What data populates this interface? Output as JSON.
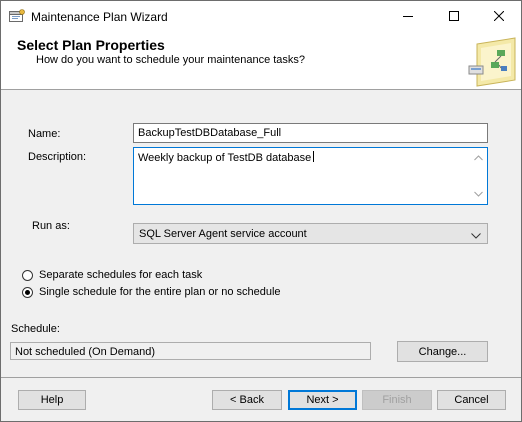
{
  "window": {
    "title": "Maintenance Plan Wizard"
  },
  "header": {
    "title": "Select Plan Properties",
    "subtitle": "How do you want to schedule your maintenance tasks?"
  },
  "form": {
    "name_label": "Name:",
    "name_value": "BackupTestDBDatabase_Full",
    "description_label": "Description:",
    "description_value": "Weekly backup of TestDB database",
    "run_as_label": "Run as:",
    "run_as_value": "SQL Server Agent service account",
    "schedule_options": [
      {
        "label": "Separate schedules for each task",
        "checked": false
      },
      {
        "label": "Single schedule for the entire plan or no schedule",
        "checked": true
      }
    ],
    "schedule_label": "Schedule:",
    "schedule_value": "Not scheduled (On Demand)",
    "change_button": "Change..."
  },
  "footer": {
    "help": "Help",
    "back": "< Back",
    "next": "Next >",
    "finish": "Finish",
    "cancel": "Cancel"
  },
  "icons": {
    "app": "wizard-app-icon",
    "minimize": "minimize-icon",
    "maximize": "maximize-icon",
    "close": "close-icon",
    "header_art": "maintenance-plan-art"
  },
  "colors": {
    "accent": "#0078d7",
    "window_bg": "#f0f0f0",
    "header_bg": "#ffffff"
  }
}
